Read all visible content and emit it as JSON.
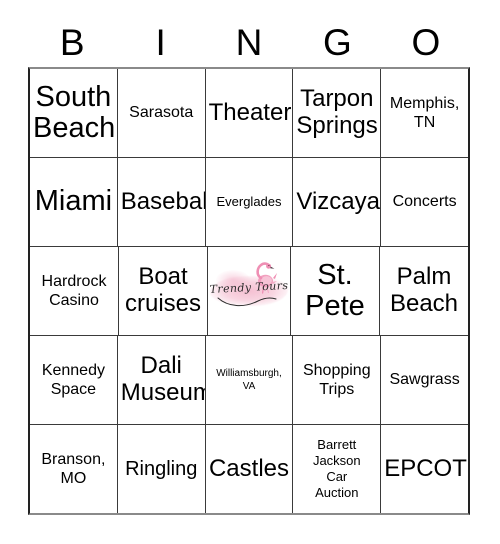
{
  "card": {
    "title": "BINGO",
    "header_letters": [
      "B",
      "I",
      "N",
      "G",
      "O"
    ],
    "free_space": {
      "position": [
        2,
        2
      ],
      "logo_name": "Trendy Tours",
      "logo_wordmark": "Trendy Tours",
      "logo_icon": "flamingo-icon",
      "colors": {
        "flamingo_pink": "#f08ab0",
        "flamingo_light": "#f7bcd2",
        "wash_pink": "#f4bace",
        "wordmark_ink": "#2b2b2b"
      }
    },
    "grid_colors": {
      "border": "#222222",
      "gridline": "#3a3a3a",
      "background": "#ffffff",
      "text": "#000000"
    },
    "rows": [
      [
        {
          "text": "South\nBeach",
          "size": "sz-xxl"
        },
        {
          "text": "Sarasota",
          "size": "sz-md"
        },
        {
          "text": "Theater",
          "size": "sz-xl"
        },
        {
          "text": "Tarpon\nSprings",
          "size": "sz-xl"
        },
        {
          "text": "Memphis,\nTN",
          "size": "sz-md"
        }
      ],
      [
        {
          "text": "Miami",
          "size": "sz-xxl"
        },
        {
          "text": "Baseball",
          "size": "sz-xl"
        },
        {
          "text": "Everglades",
          "size": "sz-sm"
        },
        {
          "text": "Vizcaya",
          "size": "sz-xl"
        },
        {
          "text": "Concerts",
          "size": "sz-md"
        }
      ],
      [
        {
          "text": "Hardrock\nCasino",
          "size": "sz-md"
        },
        {
          "text": "Boat\ncruises",
          "size": "sz-xl"
        },
        {
          "text": "",
          "size": "free"
        },
        {
          "text": "St.\nPete",
          "size": "sz-xxl"
        },
        {
          "text": "Palm\nBeach",
          "size": "sz-xl"
        }
      ],
      [
        {
          "text": "Kennedy\nSpace",
          "size": "sz-md"
        },
        {
          "text": "Dali\nMuseum",
          "size": "sz-xl"
        },
        {
          "text": "Williamsburgh,\nVA",
          "size": "sz-xs"
        },
        {
          "text": "Shopping\nTrips",
          "size": "sz-md"
        },
        {
          "text": "Sawgrass",
          "size": "sz-md"
        }
      ],
      [
        {
          "text": "Branson,\nMO",
          "size": "sz-md"
        },
        {
          "text": "Ringling",
          "size": "sz-lg"
        },
        {
          "text": "Castles",
          "size": "sz-xl"
        },
        {
          "text": "Barrett\nJackson\nCar\nAuction",
          "size": "sz-sm"
        },
        {
          "text": "EPCOT",
          "size": "sz-xl"
        }
      ]
    ]
  }
}
